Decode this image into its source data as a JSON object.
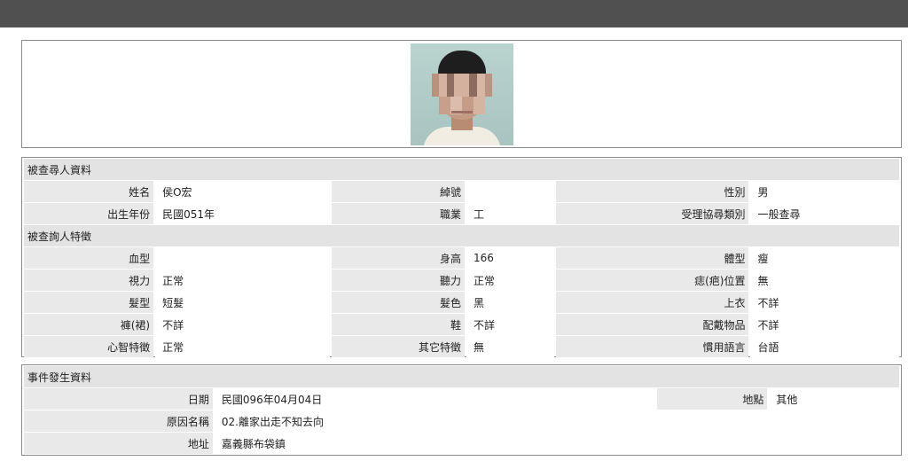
{
  "profile": {
    "section_title": "被查尋人資料",
    "name_label": "姓名",
    "name_value": "侯O宏",
    "id_label": "綽號",
    "id_value": "",
    "gender_label": "性別",
    "gender_value": "男",
    "birth_label": "出生年份",
    "birth_value": "民國051年",
    "occupation_label": "職業",
    "occupation_value": "工",
    "category_label": "受理協尋類別",
    "category_value": "一般查尋"
  },
  "features": {
    "section_title": "被查詢人特徵",
    "rows": [
      [
        {
          "label": "血型",
          "value": ""
        },
        {
          "label": "身高",
          "value": "166"
        },
        {
          "label": "體型",
          "value": "瘦"
        }
      ],
      [
        {
          "label": "視力",
          "value": "正常"
        },
        {
          "label": "聽力",
          "value": "正常"
        },
        {
          "label": "痣(疤)位置",
          "value": "無"
        }
      ],
      [
        {
          "label": "髮型",
          "value": "短髮"
        },
        {
          "label": "髮色",
          "value": "黑"
        },
        {
          "label": "上衣",
          "value": "不詳"
        }
      ],
      [
        {
          "label": "褲(裙)",
          "value": "不詳"
        },
        {
          "label": "鞋",
          "value": "不詳"
        },
        {
          "label": "配戴物品",
          "value": "不詳"
        }
      ],
      [
        {
          "label": "心智特徵",
          "value": "正常"
        },
        {
          "label": "其它特徵",
          "value": "無"
        },
        {
          "label": "慣用語言",
          "value": "台語"
        }
      ]
    ]
  },
  "event": {
    "section_title": "事件發生資料",
    "date_label": "日期",
    "date_value": "民國096年04月04日",
    "place_label": "地點",
    "place_value": "其他",
    "reason_label": "原因名稱",
    "reason_value": "02.離家出走不知去向",
    "address_label": "地址",
    "address_value": "嘉義縣布袋鎮"
  }
}
